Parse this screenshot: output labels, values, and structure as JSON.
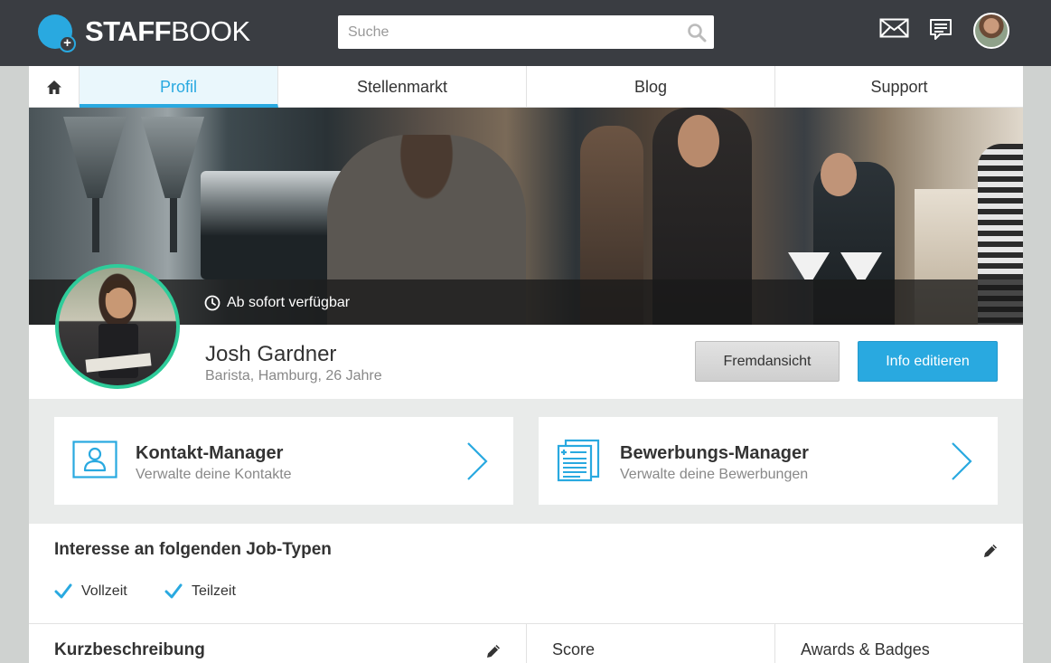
{
  "brand": {
    "name_bold": "STAFF",
    "name_light": "BOOK"
  },
  "search": {
    "placeholder": "Suche"
  },
  "nav": {
    "tabs": [
      {
        "label": "Profil",
        "active": true
      },
      {
        "label": "Stellenmarkt",
        "active": false
      },
      {
        "label": "Blog",
        "active": false
      },
      {
        "label": "Support",
        "active": false
      }
    ]
  },
  "cover": {
    "availability": "Ab sofort verfügbar"
  },
  "profile": {
    "name": "Josh Gardner",
    "subtitle": "Barista, Hamburg, 26 Jahre",
    "view_as_button": "Fremdansicht",
    "edit_button": "Info editieren"
  },
  "managers": [
    {
      "title": "Kontakt-Manager",
      "subtitle": "Verwalte deine Kontakte",
      "icon": "contact-card-icon"
    },
    {
      "title": "Bewerbungs-Manager",
      "subtitle": "Verwalte deine Bewerbungen",
      "icon": "documents-icon"
    }
  ],
  "job_types": {
    "title": "Interesse an folgenden Job-Typen",
    "items": [
      "Vollzeit",
      "Teilzeit"
    ]
  },
  "bottom": {
    "summary_title": "Kurzbeschreibung",
    "score_title": "Score",
    "awards_title": "Awards & Badges"
  },
  "colors": {
    "accent": "#29a9e0",
    "avatar_ring": "#2ecc9a",
    "topbar": "#3a3d42"
  }
}
